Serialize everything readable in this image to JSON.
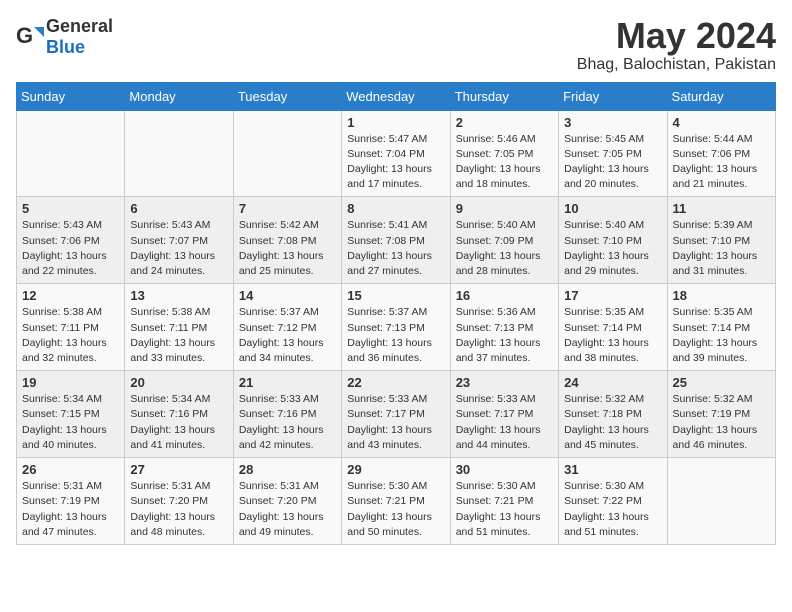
{
  "logo": {
    "general": "General",
    "blue": "Blue"
  },
  "header": {
    "month": "May 2024",
    "location": "Bhag, Balochistan, Pakistan"
  },
  "weekdays": [
    "Sunday",
    "Monday",
    "Tuesday",
    "Wednesday",
    "Thursday",
    "Friday",
    "Saturday"
  ],
  "weeks": [
    [
      {
        "day": "",
        "info": ""
      },
      {
        "day": "",
        "info": ""
      },
      {
        "day": "",
        "info": ""
      },
      {
        "day": "1",
        "info": "Sunrise: 5:47 AM\nSunset: 7:04 PM\nDaylight: 13 hours\nand 17 minutes."
      },
      {
        "day": "2",
        "info": "Sunrise: 5:46 AM\nSunset: 7:05 PM\nDaylight: 13 hours\nand 18 minutes."
      },
      {
        "day": "3",
        "info": "Sunrise: 5:45 AM\nSunset: 7:05 PM\nDaylight: 13 hours\nand 20 minutes."
      },
      {
        "day": "4",
        "info": "Sunrise: 5:44 AM\nSunset: 7:06 PM\nDaylight: 13 hours\nand 21 minutes."
      }
    ],
    [
      {
        "day": "5",
        "info": "Sunrise: 5:43 AM\nSunset: 7:06 PM\nDaylight: 13 hours\nand 22 minutes."
      },
      {
        "day": "6",
        "info": "Sunrise: 5:43 AM\nSunset: 7:07 PM\nDaylight: 13 hours\nand 24 minutes."
      },
      {
        "day": "7",
        "info": "Sunrise: 5:42 AM\nSunset: 7:08 PM\nDaylight: 13 hours\nand 25 minutes."
      },
      {
        "day": "8",
        "info": "Sunrise: 5:41 AM\nSunset: 7:08 PM\nDaylight: 13 hours\nand 27 minutes."
      },
      {
        "day": "9",
        "info": "Sunrise: 5:40 AM\nSunset: 7:09 PM\nDaylight: 13 hours\nand 28 minutes."
      },
      {
        "day": "10",
        "info": "Sunrise: 5:40 AM\nSunset: 7:10 PM\nDaylight: 13 hours\nand 29 minutes."
      },
      {
        "day": "11",
        "info": "Sunrise: 5:39 AM\nSunset: 7:10 PM\nDaylight: 13 hours\nand 31 minutes."
      }
    ],
    [
      {
        "day": "12",
        "info": "Sunrise: 5:38 AM\nSunset: 7:11 PM\nDaylight: 13 hours\nand 32 minutes."
      },
      {
        "day": "13",
        "info": "Sunrise: 5:38 AM\nSunset: 7:11 PM\nDaylight: 13 hours\nand 33 minutes."
      },
      {
        "day": "14",
        "info": "Sunrise: 5:37 AM\nSunset: 7:12 PM\nDaylight: 13 hours\nand 34 minutes."
      },
      {
        "day": "15",
        "info": "Sunrise: 5:37 AM\nSunset: 7:13 PM\nDaylight: 13 hours\nand 36 minutes."
      },
      {
        "day": "16",
        "info": "Sunrise: 5:36 AM\nSunset: 7:13 PM\nDaylight: 13 hours\nand 37 minutes."
      },
      {
        "day": "17",
        "info": "Sunrise: 5:35 AM\nSunset: 7:14 PM\nDaylight: 13 hours\nand 38 minutes."
      },
      {
        "day": "18",
        "info": "Sunrise: 5:35 AM\nSunset: 7:14 PM\nDaylight: 13 hours\nand 39 minutes."
      }
    ],
    [
      {
        "day": "19",
        "info": "Sunrise: 5:34 AM\nSunset: 7:15 PM\nDaylight: 13 hours\nand 40 minutes."
      },
      {
        "day": "20",
        "info": "Sunrise: 5:34 AM\nSunset: 7:16 PM\nDaylight: 13 hours\nand 41 minutes."
      },
      {
        "day": "21",
        "info": "Sunrise: 5:33 AM\nSunset: 7:16 PM\nDaylight: 13 hours\nand 42 minutes."
      },
      {
        "day": "22",
        "info": "Sunrise: 5:33 AM\nSunset: 7:17 PM\nDaylight: 13 hours\nand 43 minutes."
      },
      {
        "day": "23",
        "info": "Sunrise: 5:33 AM\nSunset: 7:17 PM\nDaylight: 13 hours\nand 44 minutes."
      },
      {
        "day": "24",
        "info": "Sunrise: 5:32 AM\nSunset: 7:18 PM\nDaylight: 13 hours\nand 45 minutes."
      },
      {
        "day": "25",
        "info": "Sunrise: 5:32 AM\nSunset: 7:19 PM\nDaylight: 13 hours\nand 46 minutes."
      }
    ],
    [
      {
        "day": "26",
        "info": "Sunrise: 5:31 AM\nSunset: 7:19 PM\nDaylight: 13 hours\nand 47 minutes."
      },
      {
        "day": "27",
        "info": "Sunrise: 5:31 AM\nSunset: 7:20 PM\nDaylight: 13 hours\nand 48 minutes."
      },
      {
        "day": "28",
        "info": "Sunrise: 5:31 AM\nSunset: 7:20 PM\nDaylight: 13 hours\nand 49 minutes."
      },
      {
        "day": "29",
        "info": "Sunrise: 5:30 AM\nSunset: 7:21 PM\nDaylight: 13 hours\nand 50 minutes."
      },
      {
        "day": "30",
        "info": "Sunrise: 5:30 AM\nSunset: 7:21 PM\nDaylight: 13 hours\nand 51 minutes."
      },
      {
        "day": "31",
        "info": "Sunrise: 5:30 AM\nSunset: 7:22 PM\nDaylight: 13 hours\nand 51 minutes."
      },
      {
        "day": "",
        "info": ""
      }
    ]
  ]
}
